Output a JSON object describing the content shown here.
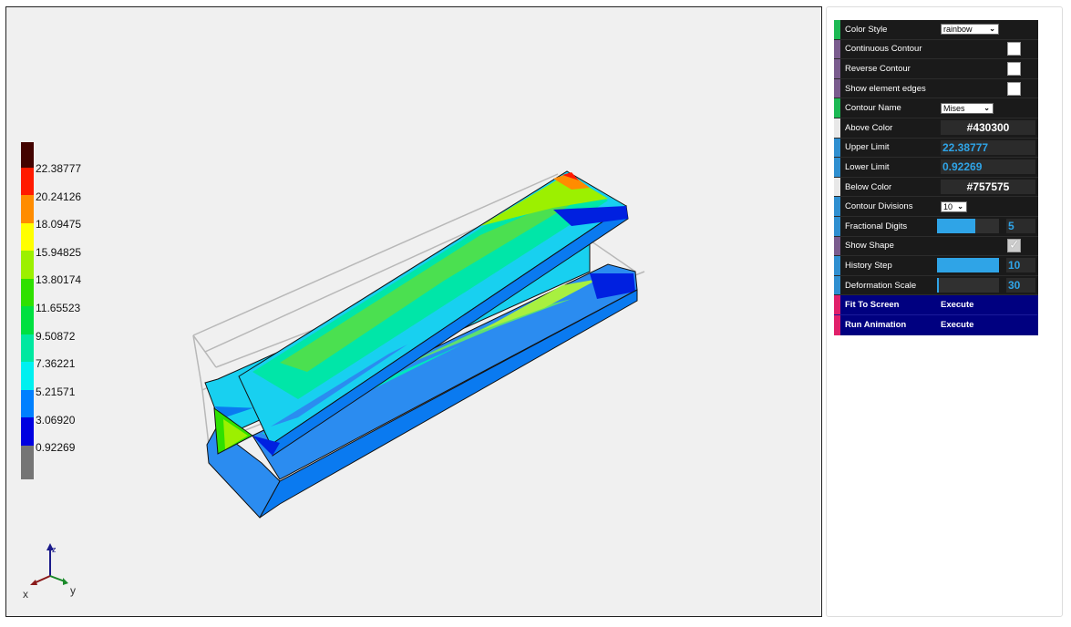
{
  "legend": {
    "labels": [
      "22.38777",
      "20.24126",
      "18.09475",
      "15.94825",
      "13.80174",
      "11.65523",
      "9.50872",
      "7.36221",
      "5.21571",
      "3.06920",
      "0.92269"
    ],
    "colors": [
      "#430300",
      "#ff1a00",
      "#ff8c00",
      "#ffff00",
      "#9cf000",
      "#2fe000",
      "#00e040",
      "#00e8a0",
      "#00f0f0",
      "#0080ff",
      "#0000e0",
      "#757575"
    ]
  },
  "axes": {
    "x": "x",
    "y": "y",
    "z": "z"
  },
  "controls": {
    "color_style": {
      "label": "Color Style",
      "value": "rainbow"
    },
    "continuous_contour": {
      "label": "Continuous Contour",
      "checked": false
    },
    "reverse_contour": {
      "label": "Reverse Contour",
      "checked": false
    },
    "show_element_edges": {
      "label": "Show element edges",
      "checked": false
    },
    "contour_name": {
      "label": "Contour Name",
      "value": "Mises"
    },
    "above_color": {
      "label": "Above Color",
      "value": "#430300"
    },
    "upper_limit": {
      "label": "Upper Limit",
      "value": "22.38777"
    },
    "lower_limit": {
      "label": "Lower Limit",
      "value": "0.92269"
    },
    "below_color": {
      "label": "Below Color",
      "value": "#757575"
    },
    "contour_divisions": {
      "label": "Contour Divisions",
      "value": "10"
    },
    "fractional_digits": {
      "label": "Fractional Digits",
      "value": "5",
      "fill": 0.62
    },
    "show_shape": {
      "label": "Show Shape",
      "checked": true
    },
    "history_step": {
      "label": "History Step",
      "value": "10",
      "fill": 1.0
    },
    "deformation_scale": {
      "label": "Deformation Scale",
      "value": "30",
      "fill": 0.03
    },
    "fit_to_screen": {
      "label": "Fit To Screen",
      "action": "Execute"
    },
    "run_animation": {
      "label": "Run Animation",
      "action": "Execute"
    }
  },
  "accent_colors": {
    "green": "#1db954",
    "purple": "#7a5c8e",
    "blue": "#2f8fd0",
    "white": "#e8e8e8",
    "pink": "#e0206a"
  }
}
